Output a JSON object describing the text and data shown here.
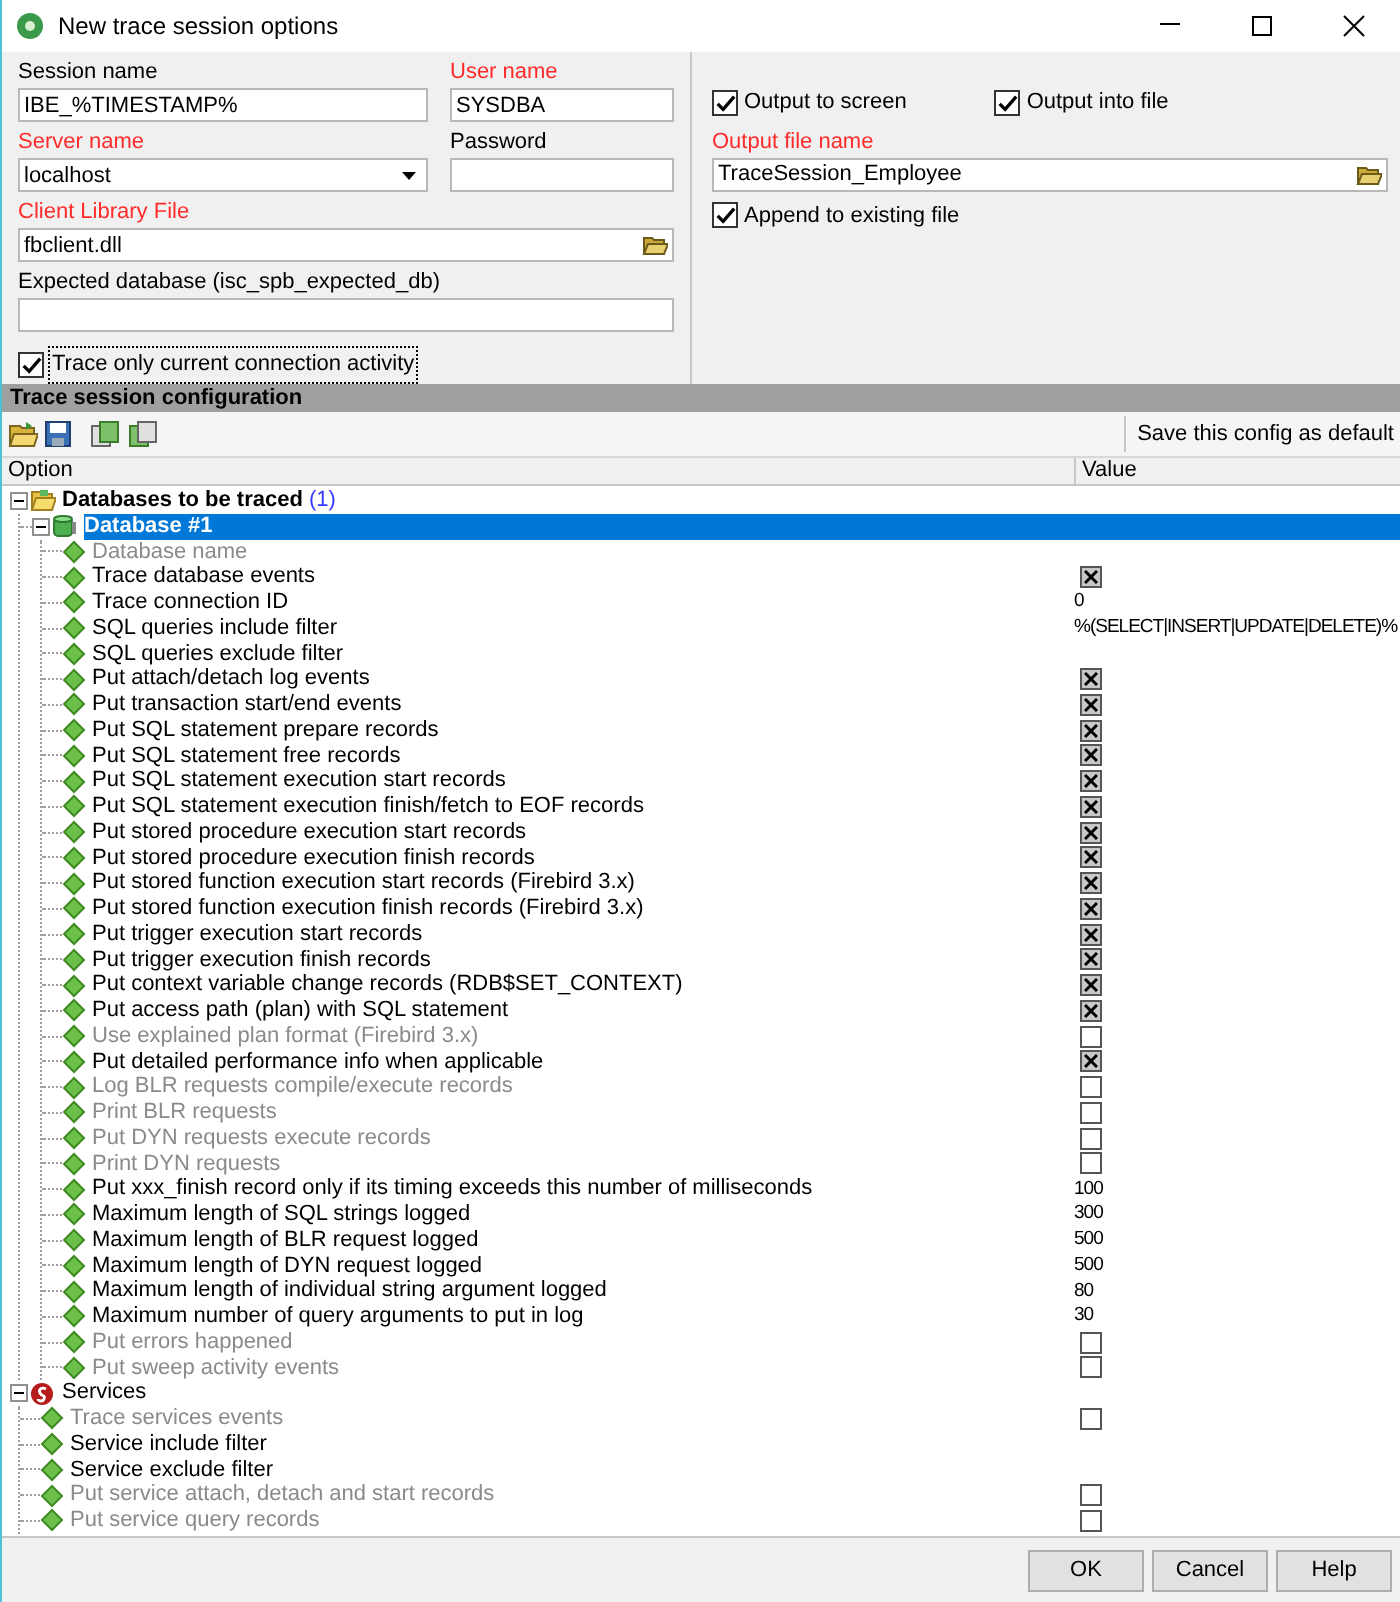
{
  "window": {
    "title": "New trace session options"
  },
  "connection": {
    "session_name": {
      "label": "Session name",
      "required": false,
      "value": "IBE_%TIMESTAMP%"
    },
    "user_name": {
      "label": "User name",
      "required": true,
      "value": "SYSDBA"
    },
    "server_name": {
      "label": "Server name",
      "required": true,
      "value": "localhost"
    },
    "password": {
      "label": "Password",
      "required": false
    },
    "client_library": {
      "label": "Client Library File",
      "required": true,
      "value": "fbclient.dll"
    },
    "expected_database": {
      "label": "Expected database (isc_spb_expected_db)",
      "required": false
    },
    "trace_only_current": {
      "label": "Trace only current connection activity",
      "checked": true,
      "focused": true
    }
  },
  "output": {
    "output_to_screen": {
      "label": "Output to screen",
      "checked": true
    },
    "output_into_file": {
      "label": "Output into file",
      "checked": true
    },
    "output_file_name": {
      "label": "Output file name",
      "required": true,
      "value": "TraceSession_Employee"
    },
    "append": {
      "label": "Append to existing file",
      "checked": true
    }
  },
  "config": {
    "title": "Trace session configuration",
    "save_default": "Save this config as default",
    "columns": [
      "Option",
      "Value"
    ],
    "tree": [
      {
        "kind": "folder",
        "label": "Databases to be traced",
        "count": "(1)",
        "expanded": true,
        "selected": false,
        "children": [
          {
            "kind": "database",
            "label": "Database #1",
            "expanded": true,
            "selected": true,
            "children": [
              {
                "kind": "blank",
                "label": "Database name",
                "disabled": true,
                "selected": false
              },
              {
                "kind": "check",
                "label": "Trace database events",
                "disabled": false,
                "checked": true,
                "selected": false
              },
              {
                "kind": "text",
                "label": "Trace connection ID",
                "disabled": false,
                "value": "0",
                "selected": false
              },
              {
                "kind": "text",
                "label": "SQL queries include filter",
                "disabled": false,
                "value": "%(SELECT|INSERT|UPDATE|DELETE)%",
                "selected": false
              },
              {
                "kind": "blank",
                "label": "SQL queries exclude filter",
                "disabled": false,
                "selected": false
              },
              {
                "kind": "check",
                "label": "Put attach/detach log events",
                "disabled": false,
                "checked": true,
                "selected": false
              },
              {
                "kind": "check",
                "label": "Put transaction start/end events",
                "disabled": false,
                "checked": true,
                "selected": false
              },
              {
                "kind": "check",
                "label": "Put SQL statement prepare records",
                "disabled": false,
                "checked": true,
                "selected": false
              },
              {
                "kind": "check",
                "label": "Put SQL statement free records",
                "disabled": false,
                "checked": true,
                "selected": false
              },
              {
                "kind": "check",
                "label": "Put SQL statement execution start records",
                "disabled": false,
                "checked": true,
                "selected": false
              },
              {
                "kind": "check",
                "label": "Put SQL statement execution finish/fetch to EOF records",
                "disabled": false,
                "checked": true,
                "selected": false
              },
              {
                "kind": "check",
                "label": "Put stored procedure execution start records",
                "disabled": false,
                "checked": true,
                "selected": false
              },
              {
                "kind": "check",
                "label": "Put stored procedure execution finish records",
                "disabled": false,
                "checked": true,
                "selected": false
              },
              {
                "kind": "check",
                "label": "Put stored function execution start records (Firebird 3.x)",
                "disabled": false,
                "checked": true,
                "selected": false
              },
              {
                "kind": "check",
                "label": "Put stored function execution finish records (Firebird 3.x)",
                "disabled": false,
                "checked": true,
                "selected": false
              },
              {
                "kind": "check",
                "label": "Put trigger execution start records",
                "disabled": false,
                "checked": true,
                "selected": false
              },
              {
                "kind": "check",
                "label": "Put trigger execution finish records",
                "disabled": false,
                "checked": true,
                "selected": false
              },
              {
                "kind": "check",
                "label": "Put context variable change records (RDB$SET_CONTEXT)",
                "disabled": false,
                "checked": true,
                "selected": false
              },
              {
                "kind": "check",
                "label": "Put access path (plan) with SQL statement",
                "disabled": false,
                "checked": true,
                "selected": false
              },
              {
                "kind": "check",
                "label": "Use explained plan format (Firebird 3.x)",
                "disabled": true,
                "checked": false,
                "selected": false
              },
              {
                "kind": "check",
                "label": "Put detailed performance info when applicable",
                "disabled": false,
                "checked": true,
                "selected": false
              },
              {
                "kind": "check",
                "label": "Log BLR requests compile/execute records",
                "disabled": true,
                "checked": false,
                "selected": false
              },
              {
                "kind": "check",
                "label": "Print BLR requests",
                "disabled": true,
                "checked": false,
                "selected": false
              },
              {
                "kind": "check",
                "label": "Put DYN requests execute records",
                "disabled": true,
                "checked": false,
                "selected": false
              },
              {
                "kind": "check",
                "label": "Print DYN requests",
                "disabled": true,
                "checked": false,
                "selected": false
              },
              {
                "kind": "text",
                "label": "Put xxx_finish record only if its timing exceeds this number of milliseconds",
                "disabled": false,
                "value": "100",
                "selected": false
              },
              {
                "kind": "text",
                "label": "Maximum length of SQL strings logged",
                "disabled": false,
                "value": "300",
                "selected": false
              },
              {
                "kind": "text",
                "label": "Maximum length of BLR request logged",
                "disabled": false,
                "value": "500",
                "selected": false
              },
              {
                "kind": "text",
                "label": "Maximum length of DYN request logged",
                "disabled": false,
                "value": "500",
                "selected": false
              },
              {
                "kind": "text",
                "label": "Maximum length of individual string argument logged",
                "disabled": false,
                "value": "80",
                "selected": false
              },
              {
                "kind": "text",
                "label": "Maximum number of query arguments to put in log",
                "disabled": false,
                "value": "30",
                "selected": false
              },
              {
                "kind": "check",
                "label": "Put errors happened",
                "disabled": true,
                "checked": false,
                "selected": false
              },
              {
                "kind": "check",
                "label": "Put sweep activity events",
                "disabled": true,
                "checked": false,
                "selected": false
              }
            ]
          }
        ]
      },
      {
        "kind": "services",
        "label": "Services",
        "expanded": true,
        "selected": false,
        "children": [
          {
            "kind": "check",
            "label": "Trace services events",
            "disabled": true,
            "checked": false,
            "selected": false
          },
          {
            "kind": "blank",
            "label": "Service include filter",
            "disabled": false,
            "selected": false
          },
          {
            "kind": "blank",
            "label": "Service exclude filter",
            "disabled": false,
            "selected": false
          },
          {
            "kind": "check",
            "label": "Put service attach, detach and start records",
            "disabled": true,
            "checked": false,
            "selected": false
          },
          {
            "kind": "check",
            "label": "Put service query records",
            "disabled": true,
            "checked": false,
            "selected": false
          }
        ]
      }
    ]
  },
  "buttons": [
    "OK",
    "Cancel",
    "Help"
  ]
}
